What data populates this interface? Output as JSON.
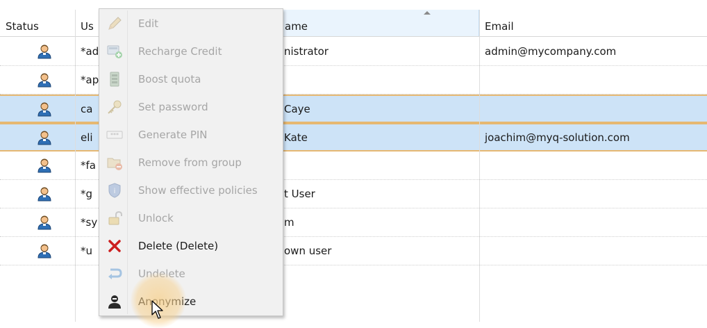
{
  "columns": {
    "status": "Status",
    "username": "Us",
    "fullname": "ame",
    "email": "Email"
  },
  "rows": [
    {
      "user": "*ad",
      "name": "nistrator",
      "email": "admin@mycompany.com",
      "selected": false
    },
    {
      "user": "*ap",
      "name": "",
      "email": "",
      "selected": false
    },
    {
      "user": "ca",
      "name": "Caye",
      "email": "",
      "selected": true
    },
    {
      "user": "eli",
      "name": "Kate",
      "email": "joachim@myq-solution.com",
      "selected": true
    },
    {
      "user": "*fa",
      "name": "",
      "email": "",
      "selected": false
    },
    {
      "user": "*g",
      "name": "t User",
      "email": "",
      "selected": false
    },
    {
      "user": "*sy",
      "name": "m",
      "email": "",
      "selected": false
    },
    {
      "user": "*u",
      "name": "own user",
      "email": "",
      "selected": false
    }
  ],
  "menu": {
    "items": [
      {
        "label": "Edit",
        "shortcut": "",
        "icon": "pencil-icon",
        "enabled": false
      },
      {
        "label": "Recharge Credit",
        "shortcut": "",
        "icon": "recharge-credit-icon",
        "enabled": false
      },
      {
        "label": "Boost quota",
        "shortcut": "",
        "icon": "boost-quota-icon",
        "enabled": false
      },
      {
        "label": "Set password",
        "shortcut": "",
        "icon": "key-icon",
        "enabled": false
      },
      {
        "label": "Generate PIN",
        "shortcut": "",
        "icon": "pin-field-icon",
        "enabled": false
      },
      {
        "label": "Remove from group",
        "shortcut": "",
        "icon": "remove-from-group-icon",
        "enabled": false
      },
      {
        "label": "Show effective policies",
        "shortcut": "",
        "icon": "shield-icon",
        "enabled": false
      },
      {
        "label": "Unlock",
        "shortcut": "",
        "icon": "unlock-icon",
        "enabled": false
      },
      {
        "label": "Delete",
        "shortcut": " (Delete)",
        "icon": "delete-x-icon",
        "enabled": true
      },
      {
        "label": "Undelete",
        "shortcut": "",
        "icon": "undelete-arrow-icon",
        "enabled": false
      },
      {
        "label": "Anonymize",
        "shortcut": "",
        "icon": "anonymize-user-icon",
        "enabled": true
      }
    ]
  },
  "colors": {
    "selection": "#cde3f7",
    "selection_border": "#e6b872",
    "delete_red": "#cc1f1f",
    "disabled_text": "#a6a6a6"
  }
}
